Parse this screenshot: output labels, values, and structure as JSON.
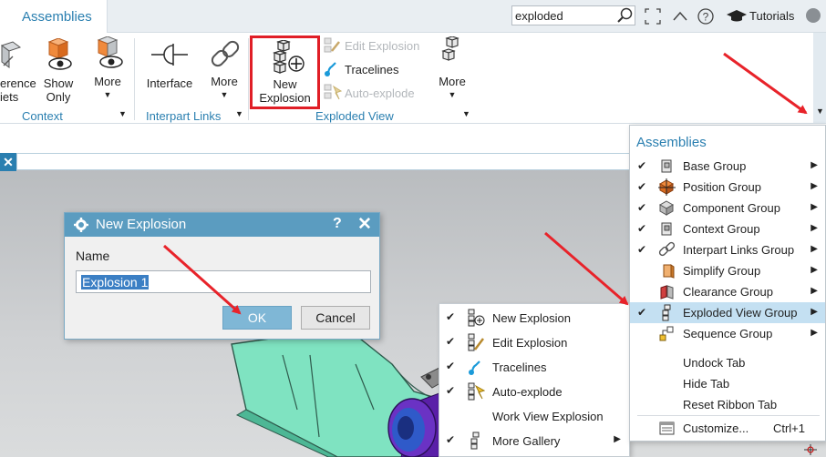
{
  "tabbar": {
    "active_tab": "Assemblies",
    "search_value": "exploded",
    "tutorials_label": "Tutorials"
  },
  "ribbon": {
    "context_group": {
      "buttons": [
        {
          "label_line1": "erence",
          "label_line2": "iets"
        },
        {
          "label_line1": "Show",
          "label_line2": "Only"
        },
        {
          "label_line1": "More",
          "label_line2": ""
        }
      ],
      "label": "Context"
    },
    "interpart_group": {
      "buttons": [
        {
          "label_line1": "Interface"
        },
        {
          "label_line1": "More"
        }
      ],
      "label": "Interpart Links"
    },
    "exploded_group": {
      "new_explosion_line1": "New",
      "new_explosion_line2": "Explosion",
      "edit_explosion": "Edit Explosion",
      "tracelines": "Tracelines",
      "auto_explode": "Auto-explode",
      "more": "More",
      "label": "Exploded View"
    }
  },
  "dialog": {
    "title": "New Explosion",
    "help": "?",
    "close": "✕",
    "name_label": "Name",
    "name_value": "Explosion 1",
    "ok_label": "OK",
    "cancel_label": "Cancel"
  },
  "gallery_menu": {
    "items": [
      {
        "label": "New Explosion",
        "checked": "✔",
        "icon": "new-explosion-icon"
      },
      {
        "label": "Edit Explosion",
        "checked": "✔",
        "icon": "edit-explosion-icon"
      },
      {
        "label": "Tracelines",
        "checked": "✔",
        "icon": "tracelines-icon"
      },
      {
        "label": "Auto-explode",
        "checked": "✔",
        "icon": "auto-explode-icon"
      },
      {
        "label": "Work View Explosion",
        "checked": "",
        "icon": ""
      },
      {
        "label": "More Gallery",
        "checked": "✔",
        "icon": "more-gallery-icon",
        "submenu": "▶"
      }
    ]
  },
  "asm_menu": {
    "title": "Assemblies",
    "items": [
      {
        "label": "Base Group",
        "checked": "✔",
        "submenu": "▶"
      },
      {
        "label": "Position Group",
        "checked": "✔",
        "submenu": "▶"
      },
      {
        "label": "Component Group",
        "checked": "✔",
        "submenu": "▶"
      },
      {
        "label": "Context Group",
        "checked": "✔",
        "submenu": "▶"
      },
      {
        "label": "Interpart Links Group",
        "checked": "✔",
        "submenu": "▶"
      },
      {
        "label": "Simplify Group",
        "checked": "",
        "submenu": "▶"
      },
      {
        "label": "Clearance Group",
        "checked": "",
        "submenu": "▶"
      },
      {
        "label": "Exploded View Group",
        "checked": "✔",
        "submenu": "▶"
      },
      {
        "label": "Sequence Group",
        "checked": "",
        "submenu": "▶"
      }
    ],
    "undock_tab": "Undock Tab",
    "hide_tab": "Hide Tab",
    "reset_ribbon_tab": "Reset Ribbon Tab",
    "customize": "Customize...",
    "customize_shortcut": "Ctrl+1"
  },
  "colors": {
    "accent": "#2a7fb0",
    "highlight_box": "#e01e26",
    "arrow": "#e8232a",
    "menu_highlight": "#c4e0f2"
  }
}
